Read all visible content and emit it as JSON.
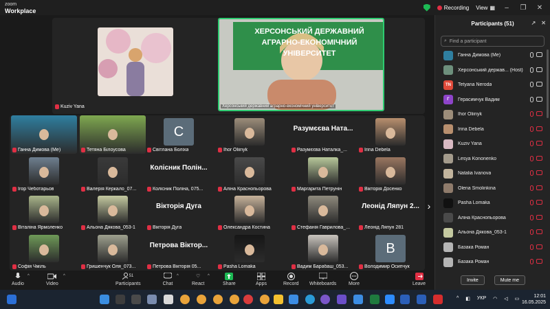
{
  "app": {
    "brand": "zoom",
    "product": "Workplace"
  },
  "titlebar": {
    "recording_label": "Recording",
    "view_label": "View"
  },
  "spotlight": [
    {
      "name": "Kuziv Yana",
      "color": "#d8b9c2"
    },
    {
      "name": "Херсонський державний аграрно-економічний університет",
      "color": "#c89a7e",
      "banner": "ХЕРСОНСЬКИЙ ДЕРЖАВНИЙ АГРАРНО-ЕКОНОМІЧНИЙ УНІВЕРСИТЕТ"
    }
  ],
  "grid": [
    [
      {
        "label": "Ганна Димова (Ме)",
        "type": "video",
        "color": "#2f7fa0"
      },
      {
        "label": "Тетяна Білоусова",
        "type": "video",
        "color": "#7fa850"
      },
      {
        "label": "Світлана Боліха",
        "type": "letter",
        "letter": "C",
        "color": "#5b6c79"
      },
      {
        "label": "Ihor Oliinyk",
        "type": "video",
        "color": "#9c8d7a"
      },
      {
        "label": "Разумєєва Наталка_...",
        "type": "name",
        "bigname": "Разумєєва Ната..."
      },
      {
        "label": "Irina Debela",
        "type": "video",
        "color": "#b88f6e"
      }
    ],
    [
      {
        "label": "Ігор Чеботарьов",
        "type": "video",
        "color": "#6e7f8f"
      },
      {
        "label": "Валерія Керкало_07...",
        "type": "video",
        "color": "#3a3a3a"
      },
      {
        "label": "Колісник Поліна, 075...",
        "type": "name",
        "bigname": "Колісник Полін..."
      },
      {
        "label": "Аліна Краснопьорова",
        "type": "video",
        "color": "#4a4a4a"
      },
      {
        "label": "Маргарита Петрунін",
        "type": "video",
        "color": "#b7c89a"
      },
      {
        "label": "Вікторія Досенко",
        "type": "video",
        "color": "#9a7660"
      }
    ],
    [
      {
        "label": "Віталіна Ярмоленко",
        "type": "video",
        "color": "#a9b58a"
      },
      {
        "label": "Альона Дякова_053-1",
        "type": "video",
        "color": "#c4c9a0"
      },
      {
        "label": "Вікторія Дуга",
        "type": "name",
        "bigname": "Вікторія Дуга"
      },
      {
        "label": "Олександра Костина",
        "type": "video",
        "color": "#c7b29a"
      },
      {
        "label": "Стефанія Гаврилова_...",
        "type": "video",
        "color": "#8f8a7d"
      },
      {
        "label": "Леонід Ляпун 281",
        "type": "name",
        "bigname": "Леонід Ляпун 2..."
      }
    ],
    [
      {
        "label": "Софія Чміль",
        "type": "video",
        "color": "#6f9a58"
      },
      {
        "label": "Гришенчук Оля_073...",
        "type": "video",
        "color": "#9ea08e"
      },
      {
        "label": "Петрова Вікторія 05...",
        "type": "name",
        "bigname": "Петрова Віктор..."
      },
      {
        "label": "Pasha Lomaka",
        "type": "video",
        "color": "#161616"
      },
      {
        "label": "Вадим Барабаш_053...",
        "type": "video",
        "color": "#c9c4bd"
      },
      {
        "label": "Володимир Осипчук",
        "type": "letter",
        "letter": "B",
        "color": "#5b6c79"
      }
    ]
  ],
  "panel": {
    "title": "Participants (51)",
    "search_placeholder": "Find a participant",
    "invite_label": "Invite",
    "mute_label": "Mute me",
    "participants": [
      {
        "name": "Ганна Димова (Me)",
        "color": "#2f7fa0",
        "initials": "",
        "muted": false
      },
      {
        "name": "Херсонський держав... (Host)",
        "color": "#6d8f7c",
        "initials": "",
        "muted": false
      },
      {
        "name": "Tetyana Neroda",
        "color": "#e04a3a",
        "initials": "TN",
        "muted": false
      },
      {
        "name": "Герасимчук Вадим",
        "color": "#8e44c9",
        "initials": "Г",
        "muted": false
      },
      {
        "name": "Ihor Oliinyk",
        "color": "#9c8d7a",
        "initials": "",
        "muted": true
      },
      {
        "name": "Irina Debela",
        "color": "#b88f6e",
        "initials": "",
        "muted": true
      },
      {
        "name": "Kuziv Yana",
        "color": "#d8b9c2",
        "initials": "",
        "muted": true
      },
      {
        "name": "Lesya Kononenko",
        "color": "#a49b8c",
        "initials": "",
        "muted": true
      },
      {
        "name": "Natalia Ivanova",
        "color": "#c2b49d",
        "initials": "",
        "muted": true
      },
      {
        "name": "Olena Smolinkina",
        "color": "#8f7b6b",
        "initials": "",
        "muted": true
      },
      {
        "name": "Pasha Lomaka",
        "color": "#111111",
        "initials": "",
        "muted": true
      },
      {
        "name": "Аліна Краснопьорова",
        "color": "#4a4a4a",
        "initials": "",
        "muted": true
      },
      {
        "name": "Альона Дякова_053-1",
        "color": "#c4c9a0",
        "initials": "",
        "muted": true
      },
      {
        "name": "Базака Роман",
        "color": "#b5b5b5",
        "initials": "",
        "muted": true
      },
      {
        "name": "Базака Роман",
        "color": "#b5b5b5",
        "initials": "",
        "muted": true
      }
    ]
  },
  "toolbar": {
    "audio": "Audio",
    "video": "Video",
    "participants": "Participants",
    "participants_count": "51",
    "chat": "Chat",
    "react": "React",
    "share": "Share",
    "apps": "Apps",
    "record": "Record",
    "whiteboards": "Whiteboards",
    "more": "More",
    "leave": "Leave"
  },
  "taskbar": {
    "lang": "УКР",
    "time": "12:01",
    "date": "16.05.2025"
  },
  "colors": {
    "accent_green": "#1db954",
    "red": "#e02f44",
    "share_green": "#1db954"
  }
}
